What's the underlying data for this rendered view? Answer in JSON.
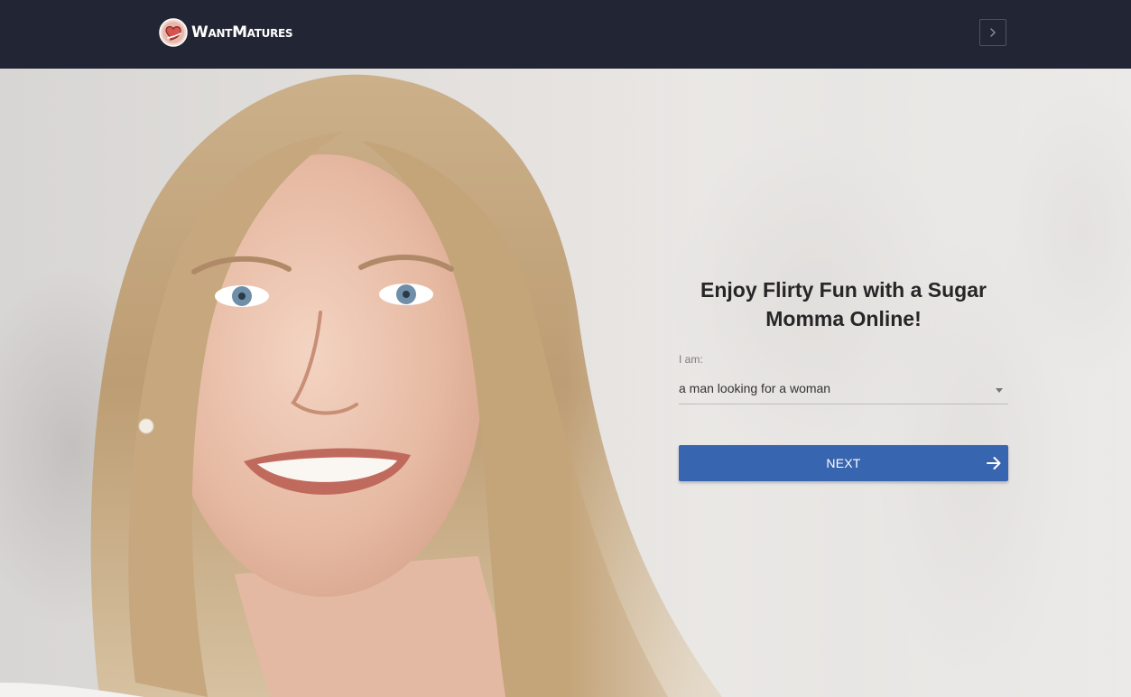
{
  "header": {
    "logo_text": "WantMatures",
    "logo_icon": "heart-badge-icon",
    "menu_button_icon": "chevron-right-icon"
  },
  "hero": {
    "photo_description_icon": "smiling-woman-photo"
  },
  "form": {
    "headline": "Enjoy Flirty Fun with a Sugar Momma Online!",
    "iam_label": "I am:",
    "select_value": "a man looking for a woman",
    "next_label": "NEXT",
    "next_icon": "arrow-right-icon"
  },
  "colors": {
    "header_bg": "#222634",
    "button_bg": "#3865b0",
    "headline": "#262626"
  }
}
